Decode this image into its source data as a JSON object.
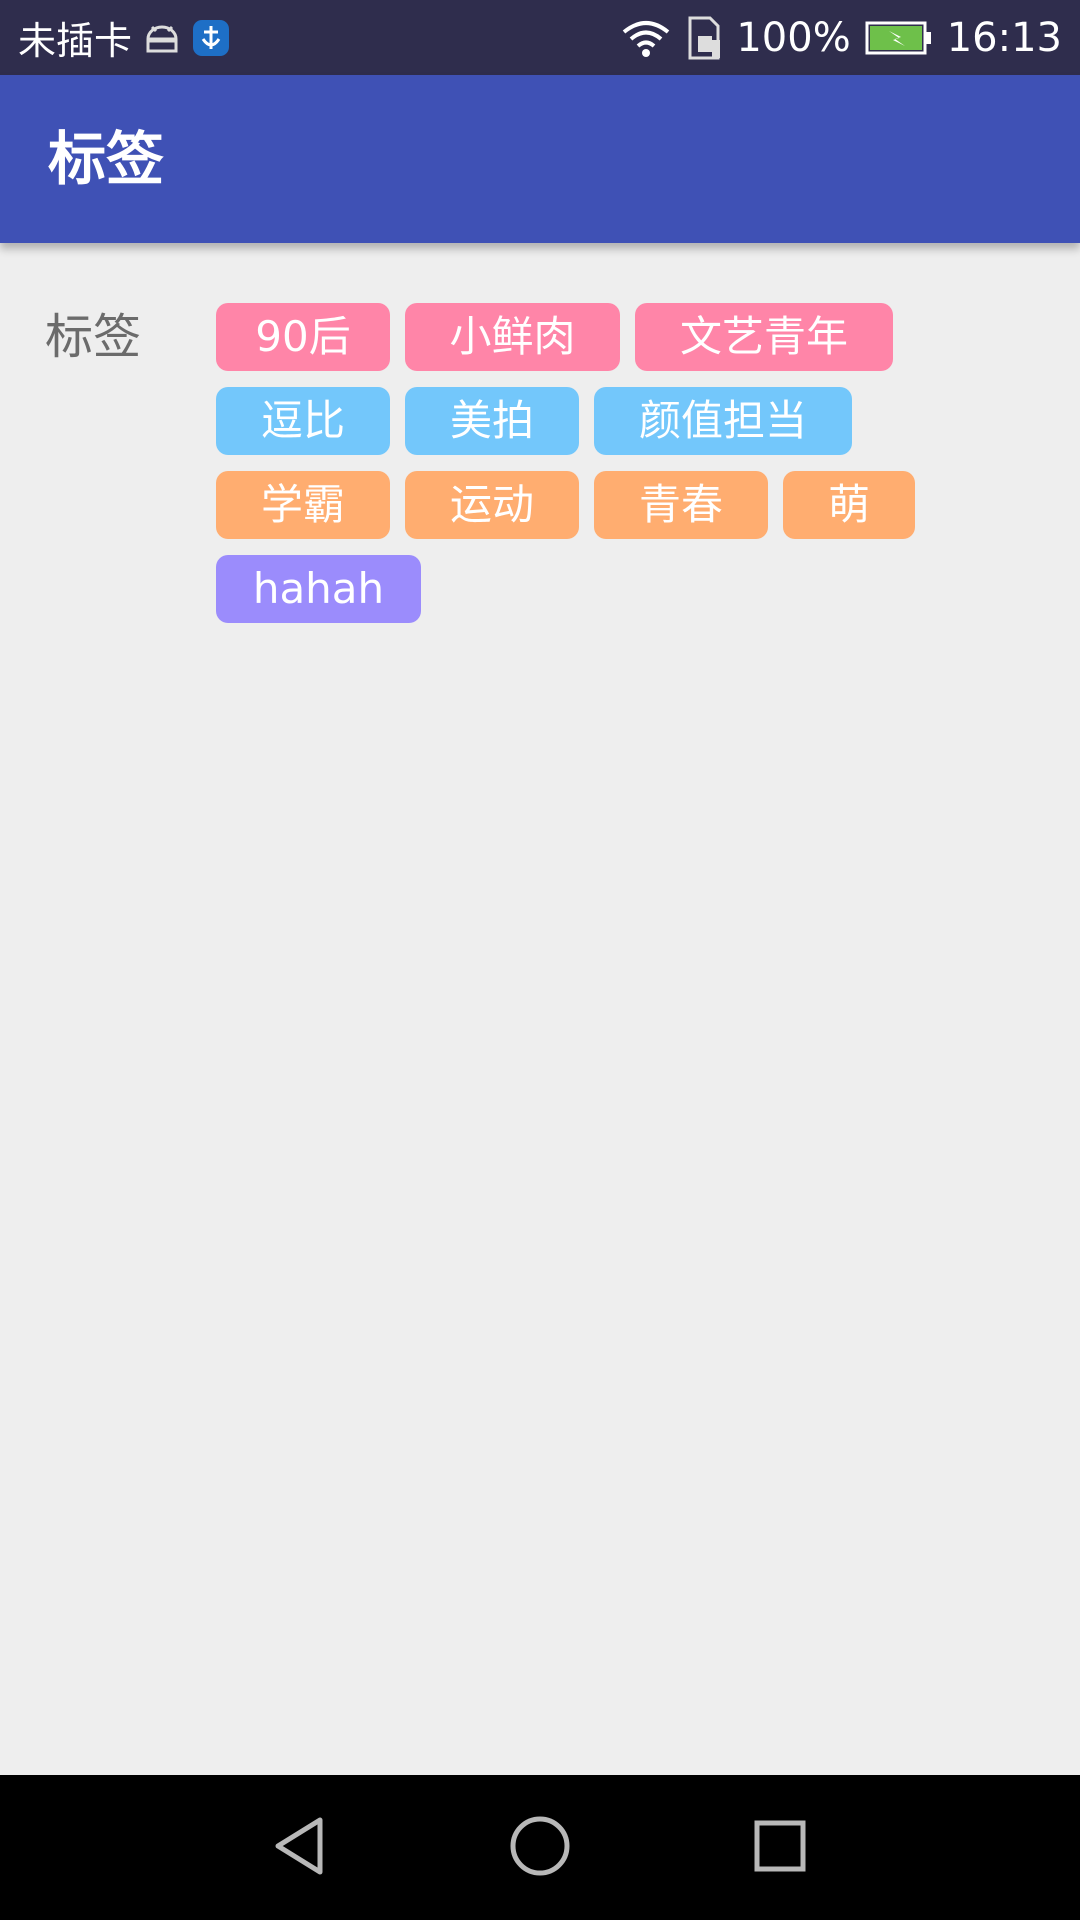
{
  "status_bar": {
    "carrier": "未插卡",
    "battery_percent": "100%",
    "time": "16:13",
    "icons": [
      "android-debug-icon",
      "app-notification-icon",
      "wifi-icon",
      "sim-card-icon",
      "battery-charging-icon"
    ]
  },
  "app_bar": {
    "title": "标签",
    "color": "#3f51b5"
  },
  "content": {
    "label": "标签",
    "tag_rows": [
      {
        "color": "#ff85a8",
        "tags": [
          "90后",
          "小鲜肉",
          "文艺青年"
        ]
      },
      {
        "color": "#73c7fb",
        "tags": [
          "逗比",
          "美拍",
          "颜值担当"
        ]
      },
      {
        "color": "#ffad70",
        "tags": [
          "学霸",
          "运动",
          "青春",
          "萌"
        ]
      },
      {
        "color": "#9b8cfc",
        "tags": [
          "hahah"
        ]
      }
    ]
  },
  "nav_bar": {
    "icons": [
      "back-icon",
      "home-icon",
      "recents-icon"
    ]
  }
}
